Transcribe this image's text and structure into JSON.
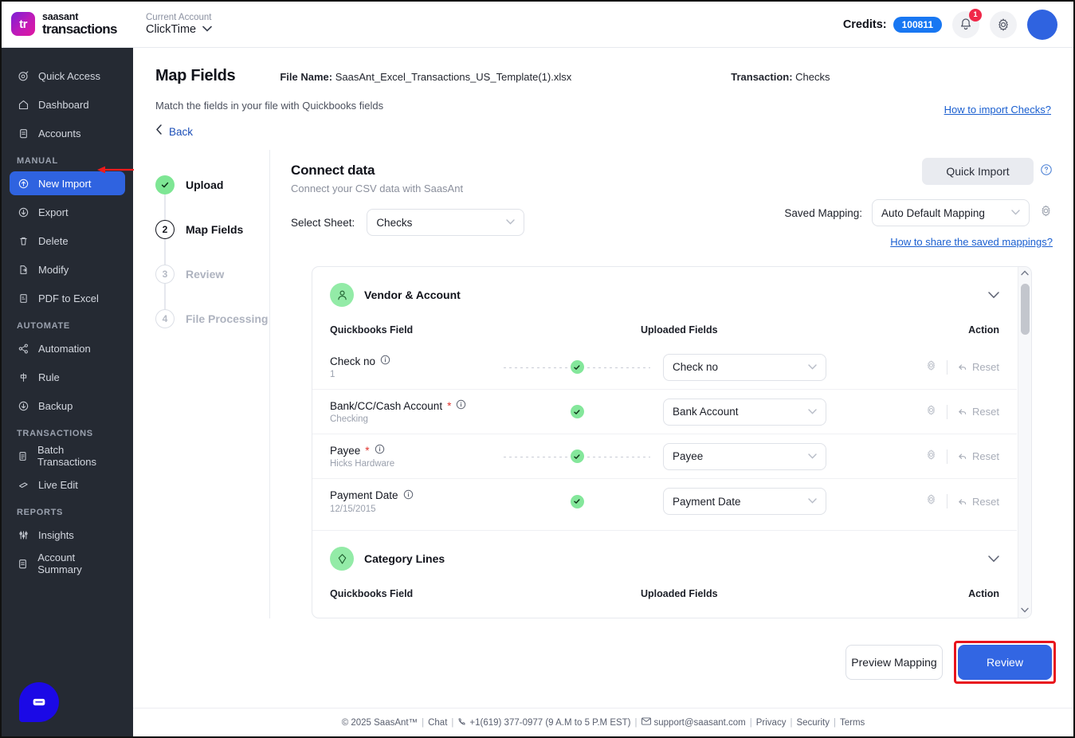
{
  "topbar": {
    "logo_mark": "tr",
    "brand_line1": "saasant",
    "brand_line2": "transactions",
    "account_label": "Current Account",
    "account_value": "ClickTime",
    "credits_label": "Credits:",
    "credits_value": "100811",
    "notification_count": "1",
    "accent_blue": "#1877f2",
    "badge_red": "#f02849"
  },
  "sidebar": {
    "items": [
      {
        "label": "Quick Access",
        "icon": "target-icon",
        "active": false
      },
      {
        "label": "Dashboard",
        "icon": "home-icon",
        "active": false
      },
      {
        "label": "Accounts",
        "icon": "clipboard-icon",
        "active": false
      }
    ],
    "sections": [
      {
        "title": "MANUAL",
        "items": [
          {
            "label": "New Import",
            "icon": "upload-cloud-icon",
            "active": true
          },
          {
            "label": "Export",
            "icon": "download-cloud-icon",
            "active": false
          },
          {
            "label": "Delete",
            "icon": "trash-icon",
            "active": false
          },
          {
            "label": "Modify",
            "icon": "file-edit-icon",
            "active": false
          },
          {
            "label": "PDF to Excel",
            "icon": "pdf-file-icon",
            "active": false
          }
        ]
      },
      {
        "title": "AUTOMATE",
        "items": [
          {
            "label": "Automation",
            "icon": "share-nodes-icon",
            "active": false
          },
          {
            "label": "Rule",
            "icon": "rule-icon",
            "active": false
          },
          {
            "label": "Backup",
            "icon": "backup-icon",
            "active": false
          }
        ]
      },
      {
        "title": "TRANSACTIONS",
        "items": [
          {
            "label": "Batch Transactions",
            "icon": "document-icon",
            "active": false
          },
          {
            "label": "Live Edit",
            "icon": "pencil-icon",
            "active": false
          }
        ]
      },
      {
        "title": "REPORTS",
        "items": [
          {
            "label": "Insights",
            "icon": "sliders-icon",
            "active": false
          },
          {
            "label": "Account Summary",
            "icon": "clipboard-icon",
            "active": false
          }
        ]
      }
    ],
    "active_color": "#2f63e0",
    "background": "#252a33"
  },
  "page": {
    "title": "Map Fields",
    "file_name_label": "File Name:",
    "file_name_value": "SaasAnt_Excel_Transactions_US_Template(1).xlsx",
    "transaction_label": "Transaction:",
    "transaction_value": "Checks",
    "subtitle": "Match the fields in your file with Quickbooks fields",
    "how_to_import_link": "How to import Checks?",
    "back_label": "Back"
  },
  "stepper": {
    "steps": [
      {
        "number": "1",
        "label": "Upload",
        "state": "done",
        "marker": "check"
      },
      {
        "number": "2",
        "label": "Map Fields",
        "state": "active",
        "marker": "2"
      },
      {
        "number": "3",
        "label": "Review",
        "state": "todo",
        "marker": "3"
      },
      {
        "number": "4",
        "label": "File Processing",
        "state": "todo",
        "marker": "4"
      }
    ]
  },
  "connect": {
    "title": "Connect data",
    "subtitle": "Connect your CSV data with SaasAnt",
    "select_sheet_label": "Select Sheet:",
    "select_sheet_value": "Checks",
    "quick_import_label": "Quick Import",
    "saved_mapping_label": "Saved Mapping:",
    "saved_mapping_value": "Auto Default Mapping",
    "share_mappings_link": "How to share the saved mappings?"
  },
  "mapping": {
    "columns": {
      "quickbooks_field": "Quickbooks Field",
      "uploaded_fields": "Uploaded Fields",
      "action": "Action"
    },
    "sections": [
      {
        "name": "Vendor & Account",
        "icon": "person-icon",
        "rows": [
          {
            "qb_field": "Check no",
            "required": false,
            "sample": "1",
            "uploaded": "Check no",
            "mapped": true,
            "reset_label": "Reset"
          },
          {
            "qb_field": "Bank/CC/Cash Account",
            "required": true,
            "sample": "Checking",
            "uploaded": "Bank Account",
            "mapped": true,
            "reset_label": "Reset"
          },
          {
            "qb_field": "Payee",
            "required": true,
            "sample": "Hicks Hardware",
            "uploaded": "Payee",
            "mapped": true,
            "reset_label": "Reset"
          },
          {
            "qb_field": "Payment Date",
            "required": false,
            "sample": "12/15/2015",
            "uploaded": "Payment Date",
            "mapped": true,
            "reset_label": "Reset"
          }
        ]
      },
      {
        "name": "Category Lines",
        "icon": "tag-icon",
        "rows": []
      }
    ]
  },
  "actions": {
    "preview_mapping_label": "Preview Mapping",
    "review_label": "Review",
    "review_highlight_color": "#e8141c",
    "primary_color": "#3266e3"
  },
  "footer": {
    "copyright": "© 2025 SaasAnt™",
    "chat": "Chat",
    "phone": "+1(619) 377-0977 (9 A.M to 5 P.M EST)",
    "email": "support@saasant.com",
    "privacy": "Privacy",
    "security": "Security",
    "terms": "Terms"
  }
}
